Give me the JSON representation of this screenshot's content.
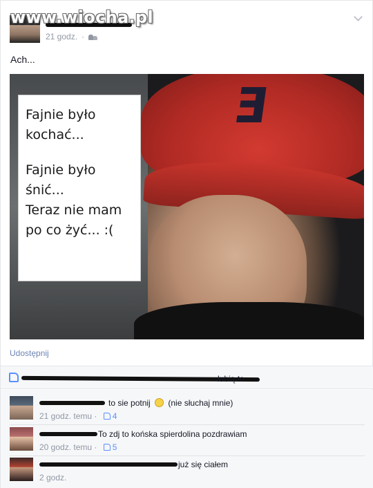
{
  "watermark": "www.wiocha.pl",
  "post": {
    "timestamp": "21 godz.",
    "text": "Ach...",
    "image_caption_lines": [
      "Fajnie było",
      "kochać...",
      "Fajnie było",
      "śnić...",
      "Teraz nie mam",
      "po co żyć... :("
    ],
    "share_label": "Udostępnij"
  },
  "likes": {
    "suffix": "lubią to."
  },
  "comments": [
    {
      "text": "to sie potnij",
      "after_emoji": "(nie słuchaj mnie)",
      "time": "21 godz. temu",
      "likes": "4"
    },
    {
      "text": "To zdj to końska spierdolina pozdrawiam",
      "time": "20 godz. temu",
      "likes": "5"
    },
    {
      "text": "już się ciałem",
      "time": "2 godz."
    }
  ],
  "colors": {
    "link": "#6d84b4",
    "like_blue": "#5890ff",
    "meta_gray": "#9197a3"
  },
  "icons": [
    "friends-icon",
    "chevron-down-icon",
    "like-thumb-icon",
    "smiley-icon"
  ]
}
